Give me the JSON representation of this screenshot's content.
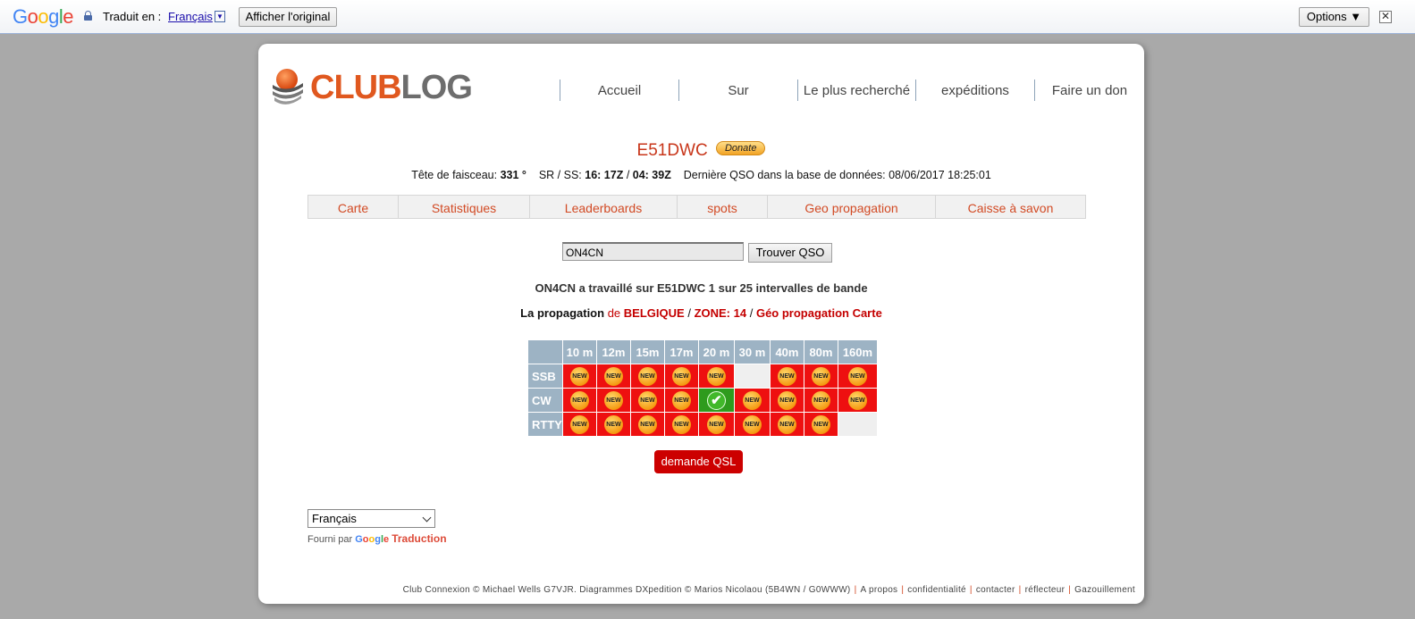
{
  "translate_bar": {
    "brand": "Google",
    "translated_to_label": "Traduit en :",
    "language": "Français",
    "show_original_label": "Afficher l'original",
    "options_label": "Options ▼",
    "close_glyph": "✕"
  },
  "site": {
    "logo_part1": "CLUB",
    "logo_part2": "LOG",
    "nav": [
      "Accueil",
      "Sur",
      "Le plus recherché",
      "expéditions",
      "Faire un don"
    ]
  },
  "header": {
    "callsign": "E51DWC",
    "donate_label": "Donate",
    "beam_label": "Tête de faisceau:",
    "beam_value": "331 °",
    "srss_label": "SR / SS:",
    "sr_value": "16: 17Z",
    "ss_value": "04: 39Z",
    "last_qso_label": "Dernière QSO dans la base de données:",
    "last_qso_value": "08/06/2017 18:25:01"
  },
  "tabs": [
    "Carte",
    "Statistiques",
    "Leaderboards",
    "spots",
    "Geo propagation",
    "Caisse à savon"
  ],
  "search": {
    "value": "ON4CN",
    "button_label": "Trouver QSO"
  },
  "result": {
    "worked_text": "ON4CN a travaillé sur E51DWC 1 sur 25 intervalles de bande",
    "prop_label": "La propagation",
    "prop_de": "de",
    "country": "BELGIQUE",
    "zone": "ZONE: 14",
    "geo_link": "Géo propagation Carte"
  },
  "band_table": {
    "bands": [
      "10 m",
      "12m",
      "15m",
      "17m",
      "20 m",
      "30 m",
      "40m",
      "80m",
      "160m"
    ],
    "badge_new": "NEW",
    "badge_ok": "✔",
    "rows": [
      {
        "mode": "SSB",
        "cells": [
          "new",
          "new",
          "new",
          "new",
          "new",
          "empty",
          "new",
          "new",
          "new"
        ]
      },
      {
        "mode": "CW",
        "cells": [
          "new",
          "new",
          "new",
          "new",
          "ok",
          "new",
          "new",
          "new",
          "new"
        ]
      },
      {
        "mode": "RTTY",
        "cells": [
          "new",
          "new",
          "new",
          "new",
          "new",
          "new",
          "new",
          "new",
          "empty"
        ]
      }
    ]
  },
  "qsl_button": "demande QSL",
  "language_select": {
    "value": "Français",
    "powered_by": "Fourni par",
    "google": "Google",
    "translate": "Traduction"
  },
  "footer": {
    "credits": "Club Connexion © Michael Wells G7VJR. Diagrammes DXpedition © Marios Nicolaou (5B4WN / G0WWW)",
    "links": [
      "A propos",
      "confidentialité",
      "contacter",
      "réflecteur",
      "Gazouillement"
    ]
  },
  "colors": {
    "accent": "#d24a24",
    "new_cell": "#ee1010",
    "ok_cell": "#2e9b1d",
    "header_cell": "#9db3c4"
  }
}
